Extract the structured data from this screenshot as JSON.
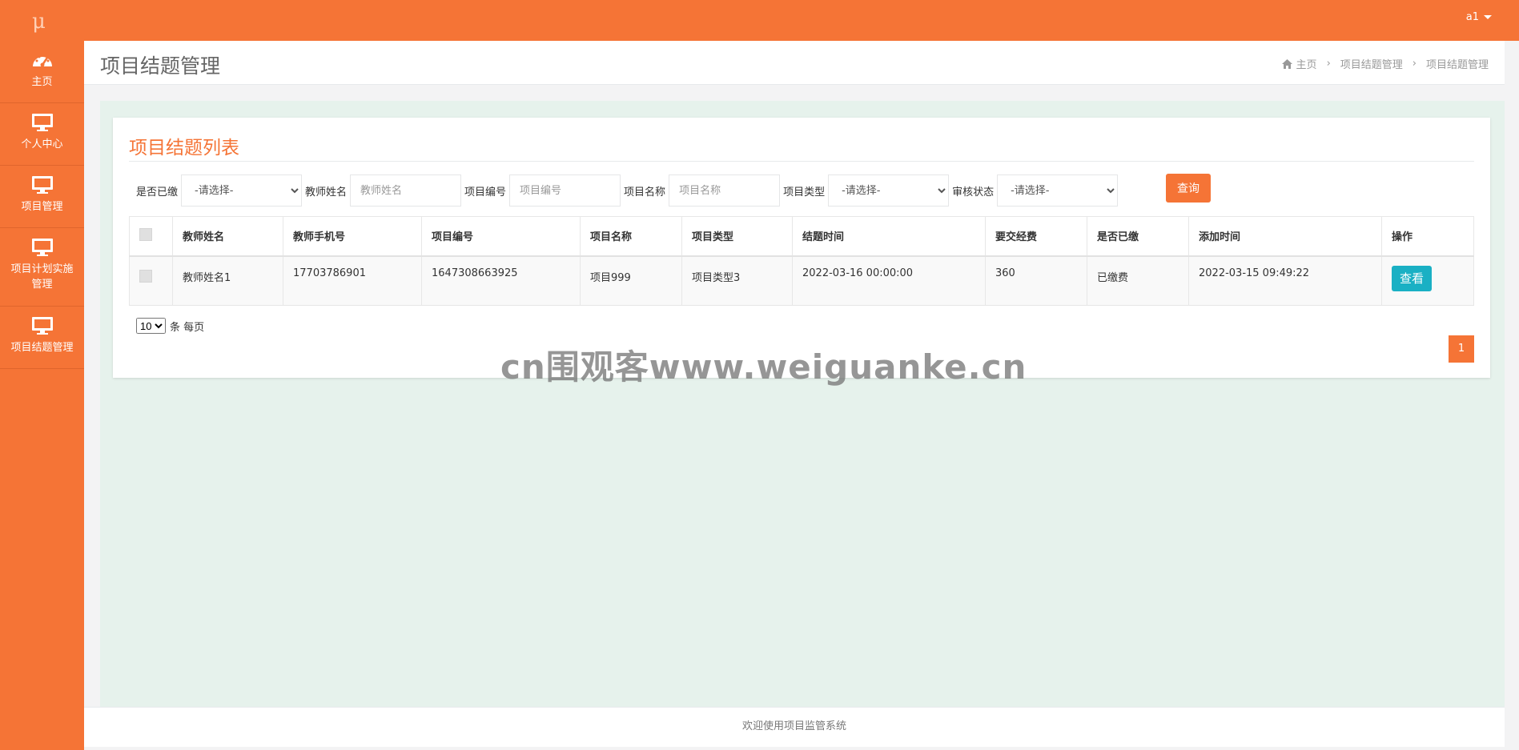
{
  "app": {
    "logo": "μ",
    "user": "a1"
  },
  "sidebar": {
    "items": [
      {
        "label": "主页",
        "icon": "dashboard-icon"
      },
      {
        "label": "个人中心",
        "icon": "monitor-icon"
      },
      {
        "label": "项目管理",
        "icon": "monitor-icon"
      },
      {
        "label": "项目计划实施管理",
        "icon": "monitor-icon"
      },
      {
        "label": "项目结题管理",
        "icon": "monitor-icon"
      }
    ]
  },
  "header": {
    "title": "项目结题管理",
    "breadcrumb": [
      "主页",
      "项目结题管理",
      "项目结题管理"
    ]
  },
  "panel": {
    "title": "项目结题列表"
  },
  "filters": {
    "paid_label": "是否已缴",
    "paid_value": "-请选择-",
    "teacher_label": "教师姓名",
    "teacher_placeholder": "教师姓名",
    "code_label": "项目编号",
    "code_placeholder": "项目编号",
    "name_label": "项目名称",
    "name_placeholder": "项目名称",
    "type_label": "项目类型",
    "type_value": "-请选择-",
    "status_label": "审核状态",
    "status_value": "-请选择-",
    "query_button": "查询"
  },
  "table": {
    "columns": [
      "教师姓名",
      "教师手机号",
      "项目编号",
      "项目名称",
      "项目类型",
      "结题时间",
      "要交经费",
      "是否已缴",
      "添加时间",
      "操作"
    ],
    "rows": [
      {
        "teacher": "教师姓名1",
        "phone": "17703786901",
        "code": "1647308663925",
        "name": "项目999",
        "type": "项目类型3",
        "end_time": "2022-03-16 00:00:00",
        "fee": "360",
        "paid": "已缴费",
        "added": "2022-03-15 09:49:22",
        "action": "查看"
      }
    ]
  },
  "pagination": {
    "page_size": "10",
    "page_size_suffix": "条 每页",
    "current_page": "1"
  },
  "watermark": "cn围观客www.weiguanke.cn",
  "footer": "欢迎使用项目监管系统",
  "colors": {
    "brand": "#F57436",
    "view_button": "#1ab0c4",
    "content_bg": "#e6f2ec"
  }
}
